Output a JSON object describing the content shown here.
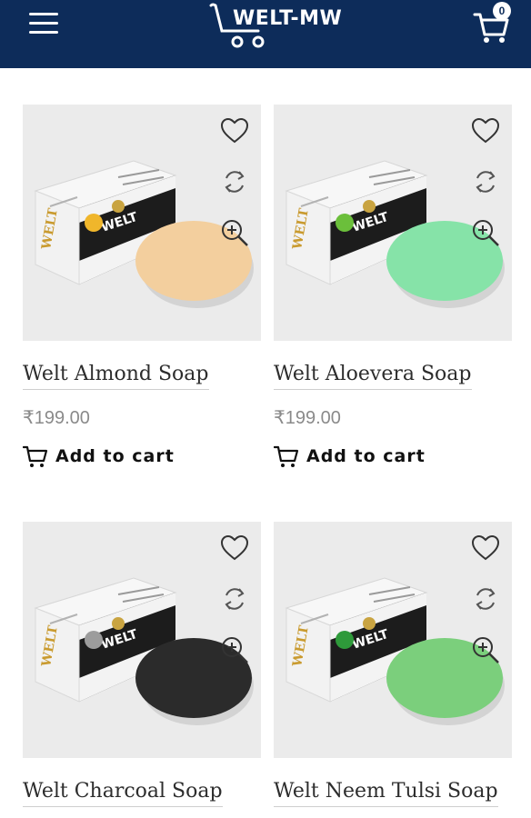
{
  "header": {
    "logo_text": "WELT-MW",
    "cart_count": "0"
  },
  "products": [
    {
      "name": "Welt Almond Soap",
      "price": "₹199.00",
      "add_to_cart": "Add to cart",
      "soap_color": "#f3cf9e",
      "badge_color": "#f0b62b"
    },
    {
      "name": "Welt Aloevera Soap",
      "price": "₹199.00",
      "add_to_cart": "Add to cart",
      "soap_color": "#86e3a8",
      "badge_color": "#6bbf3b"
    },
    {
      "name": "Welt Charcoal Soap",
      "price": "",
      "add_to_cart": "",
      "soap_color": "#2b2b2b",
      "badge_color": "#9c9c9c"
    },
    {
      "name": "Welt Neem Tulsi Soap",
      "price": "",
      "add_to_cart": "",
      "soap_color": "#7bcf7c",
      "badge_color": "#2e9a3a"
    }
  ],
  "colors": {
    "header_bg": "#0d2c5a",
    "price_text": "#8a8a8a"
  },
  "icons": {
    "wishlist": "heart-icon",
    "compare": "refresh-icon",
    "quick_view": "zoom-in-icon",
    "cart": "cart-icon"
  }
}
